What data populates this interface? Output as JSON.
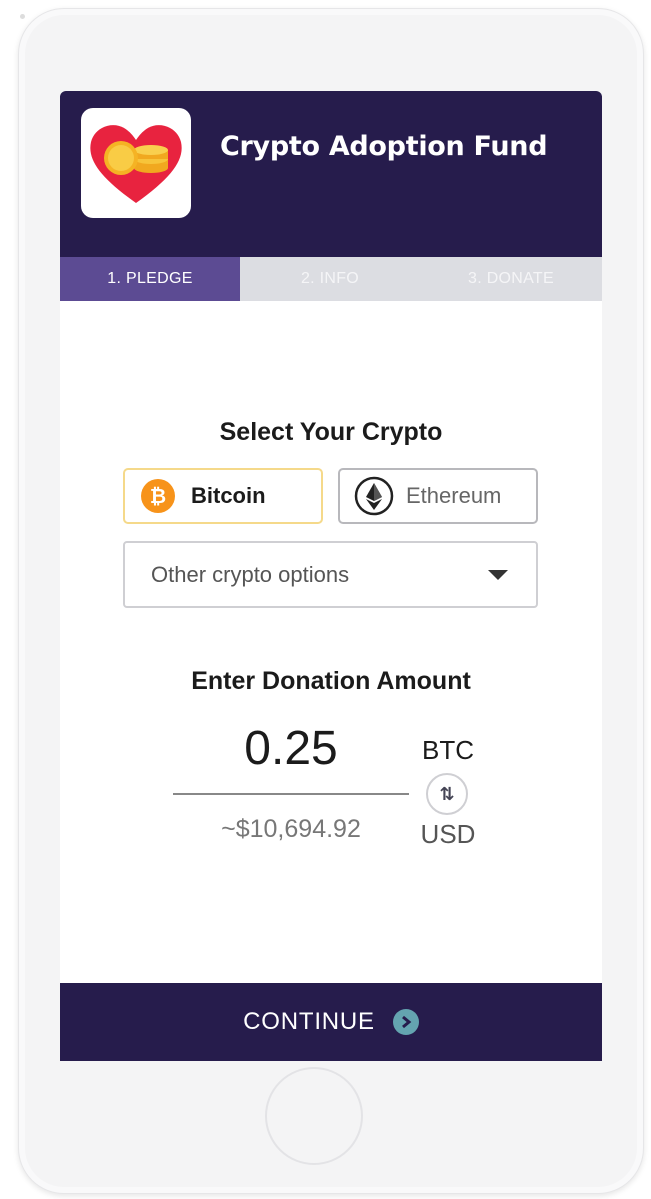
{
  "header": {
    "title": "Crypto Adoption Fund",
    "logo_icon": "heart-coins-logo"
  },
  "steps": [
    {
      "label": "1. PLEDGE",
      "active": true
    },
    {
      "label": "2. INFO",
      "active": false
    },
    {
      "label": "3. DONATE",
      "active": false
    }
  ],
  "crypto": {
    "section_title": "Select Your Crypto",
    "options": [
      {
        "label": "Bitcoin",
        "icon": "bitcoin-icon",
        "selected": true
      },
      {
        "label": "Ethereum",
        "icon": "ethereum-icon",
        "selected": false
      }
    ],
    "other_placeholder": "Other crypto options"
  },
  "donation": {
    "section_title": "Enter Donation Amount",
    "amount": "0.25",
    "primary_unit": "BTC",
    "secondary_unit": "USD",
    "fiat_value": "~$10,694.92",
    "swap_icon": "swap-arrows-icon"
  },
  "footer": {
    "continue_label": "CONTINUE",
    "continue_icon": "chevron-right-circle-icon"
  },
  "colors": {
    "brand_dark": "#261c4c",
    "step_active": "#5c4b93",
    "bitcoin_orange": "#f7931a",
    "accent_teal": "#64a4b0"
  }
}
